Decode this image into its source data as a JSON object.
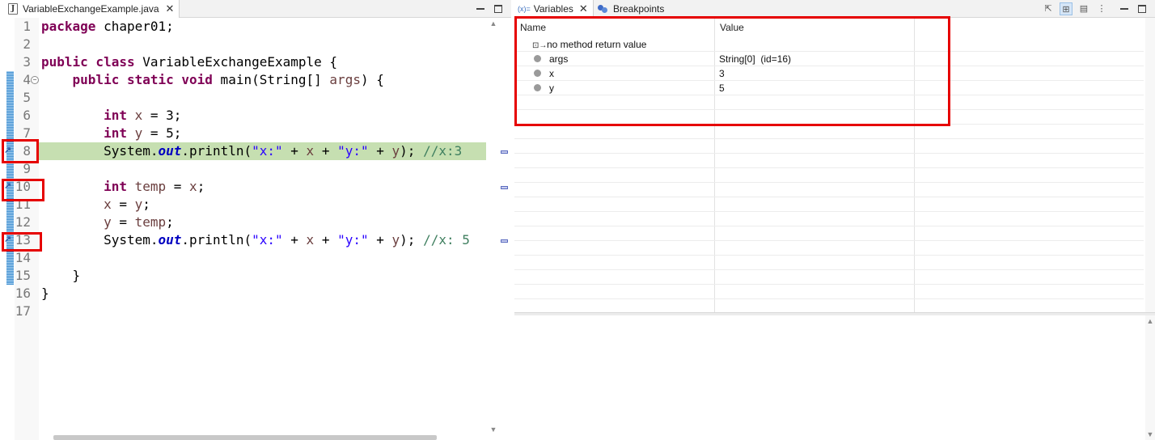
{
  "editor": {
    "tab_title": "VariableExchangeExample.java",
    "tab_close": "✕",
    "minimize": "",
    "maximize": "",
    "lines": [
      {
        "n": "1"
      },
      {
        "n": "2"
      },
      {
        "n": "3"
      },
      {
        "n": "4"
      },
      {
        "n": "5"
      },
      {
        "n": "6"
      },
      {
        "n": "7"
      },
      {
        "n": "8"
      },
      {
        "n": "9"
      },
      {
        "n": "10"
      },
      {
        "n": "11"
      },
      {
        "n": "12"
      },
      {
        "n": "13"
      },
      {
        "n": "14"
      },
      {
        "n": "15"
      },
      {
        "n": "16"
      },
      {
        "n": "17"
      }
    ],
    "code": {
      "l1_kw": "package",
      "l1_rest": " chaper01;",
      "l3_kw": "public class",
      "l3_rest": " VariableExchangeExample {",
      "l4_indent": "    ",
      "l4_kw": "public static void",
      "l4_mid": " main(String[] ",
      "l4_arg": "args",
      "l4_end": ") {",
      "l6_kw": "int",
      "l6_var": "x",
      "l6_rest": " = 3;",
      "l7_kw": "int",
      "l7_var": "y",
      "l7_rest": " = 5;",
      "print_a": "System.",
      "print_out": "out",
      "print_b": ".println(",
      "print_s1": "\"x:\"",
      "print_plus1": " + ",
      "print_x": "x",
      "print_plus2": " + ",
      "print_s2": "\"y:\"",
      "print_plus3": " + ",
      "print_y": "y",
      "print_end": "); ",
      "l8_comment": "//x:3",
      "l10_kw": "int",
      "l10_var": "temp",
      "l10_eq": " = ",
      "l10_val": "x",
      "l10_end": ";",
      "l11_var": "x",
      "l11_eq": " = ",
      "l11_val": "y",
      "l11_end": ";",
      "l12_var": "y",
      "l12_eq": " = ",
      "l12_val": "temp",
      "l12_end": ";",
      "l13_comment": "//x: 5",
      "l15": "}",
      "l16": "}"
    },
    "breakpoint_lines": [
      "8",
      "10",
      "13"
    ],
    "current_line": "8"
  },
  "variables_view": {
    "tab_label": "Variables",
    "tab_prefix": "(x)=",
    "tab_close": "✕",
    "breakpoints_tab": "Breakpoints",
    "toolbar_icons": [
      "collapse-all-icon",
      "show-type-names-icon",
      "layout-icon",
      "view-menu-icon",
      "minimize-icon",
      "maximize-icon"
    ],
    "columns": {
      "name": "Name",
      "value": "Value"
    },
    "rows": [
      {
        "name": "no method return value",
        "value": "",
        "icon": "return-value-icon"
      },
      {
        "name": "args",
        "value": "String[0]  (id=16)",
        "icon": "local-variable-icon"
      },
      {
        "name": "x",
        "value": "3",
        "icon": "local-variable-icon"
      },
      {
        "name": "y",
        "value": "5",
        "icon": "local-variable-icon"
      }
    ]
  },
  "colors": {
    "keyword": "#7f0055",
    "string": "#2a00ff",
    "comment": "#3f7f5f",
    "current_line": "#c6dfb1",
    "highlight_box": "#e60000"
  }
}
